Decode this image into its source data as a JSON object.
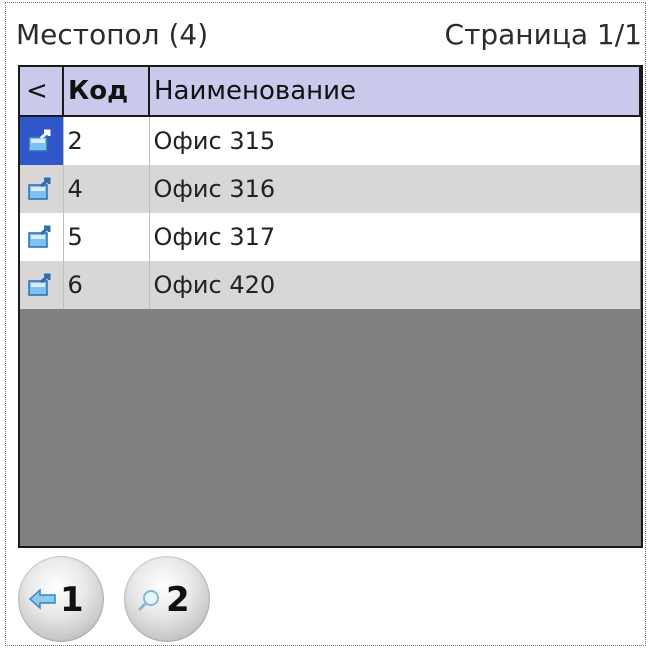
{
  "header": {
    "title": "Местопол (4)",
    "page_indicator": "Страница 1/1"
  },
  "grid": {
    "columns": [
      "<",
      "Код",
      "Наименование"
    ],
    "rows": [
      {
        "code": "2",
        "name": "Офис 315",
        "icon": "location-icon",
        "selected": true
      },
      {
        "code": "4",
        "name": "Офис 316",
        "icon": "location-icon",
        "selected": false
      },
      {
        "code": "5",
        "name": "Офис 317",
        "icon": "location-icon",
        "selected": false
      },
      {
        "code": "6",
        "name": "Офис 420",
        "icon": "location-icon",
        "selected": false
      }
    ],
    "colors": {
      "header_bg": "#c9c9ec",
      "row_even": "#ffffff",
      "row_odd": "#d9d6d6",
      "empty_bg": "#808080",
      "selected_marker": "#2f57c9"
    }
  },
  "footer": {
    "buttons": [
      {
        "label": "1",
        "icon": "back-arrow-icon"
      },
      {
        "label": "2",
        "icon": "magnifier-icon"
      }
    ]
  }
}
